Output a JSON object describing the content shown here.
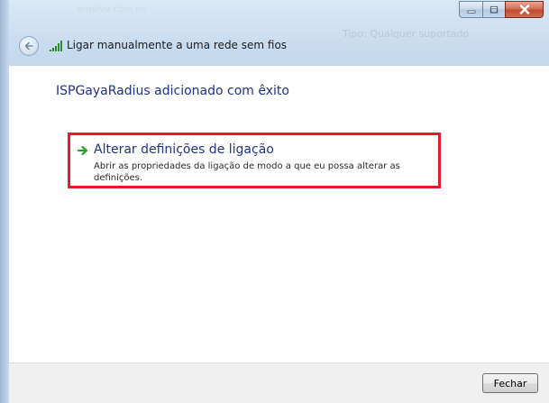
{
  "window": {
    "title": "Ligar manualmente a uma rede sem fios",
    "background_title": "Tipo: Qualquer suportado",
    "background_title_left": "arquivo com os"
  },
  "content": {
    "heading": "ISPGayaRadius adicionado com êxito",
    "option": {
      "title": "Alterar definições de ligação",
      "description": "Abrir as propriedades da ligação de modo a que eu possa alterar as definições."
    }
  },
  "footer": {
    "close_label": "Fechar"
  },
  "icons": {
    "back": "back-arrow-icon",
    "network": "wireless-signal-icon",
    "option_arrow": "green-arrow-icon",
    "minimize": "minimize-icon",
    "maximize": "maximize-icon",
    "close": "close-x-icon"
  },
  "colors": {
    "link": "#1e3287",
    "highlight": "#e8192c",
    "arrow": "#2aa52a",
    "close_button": "#c24b31"
  }
}
